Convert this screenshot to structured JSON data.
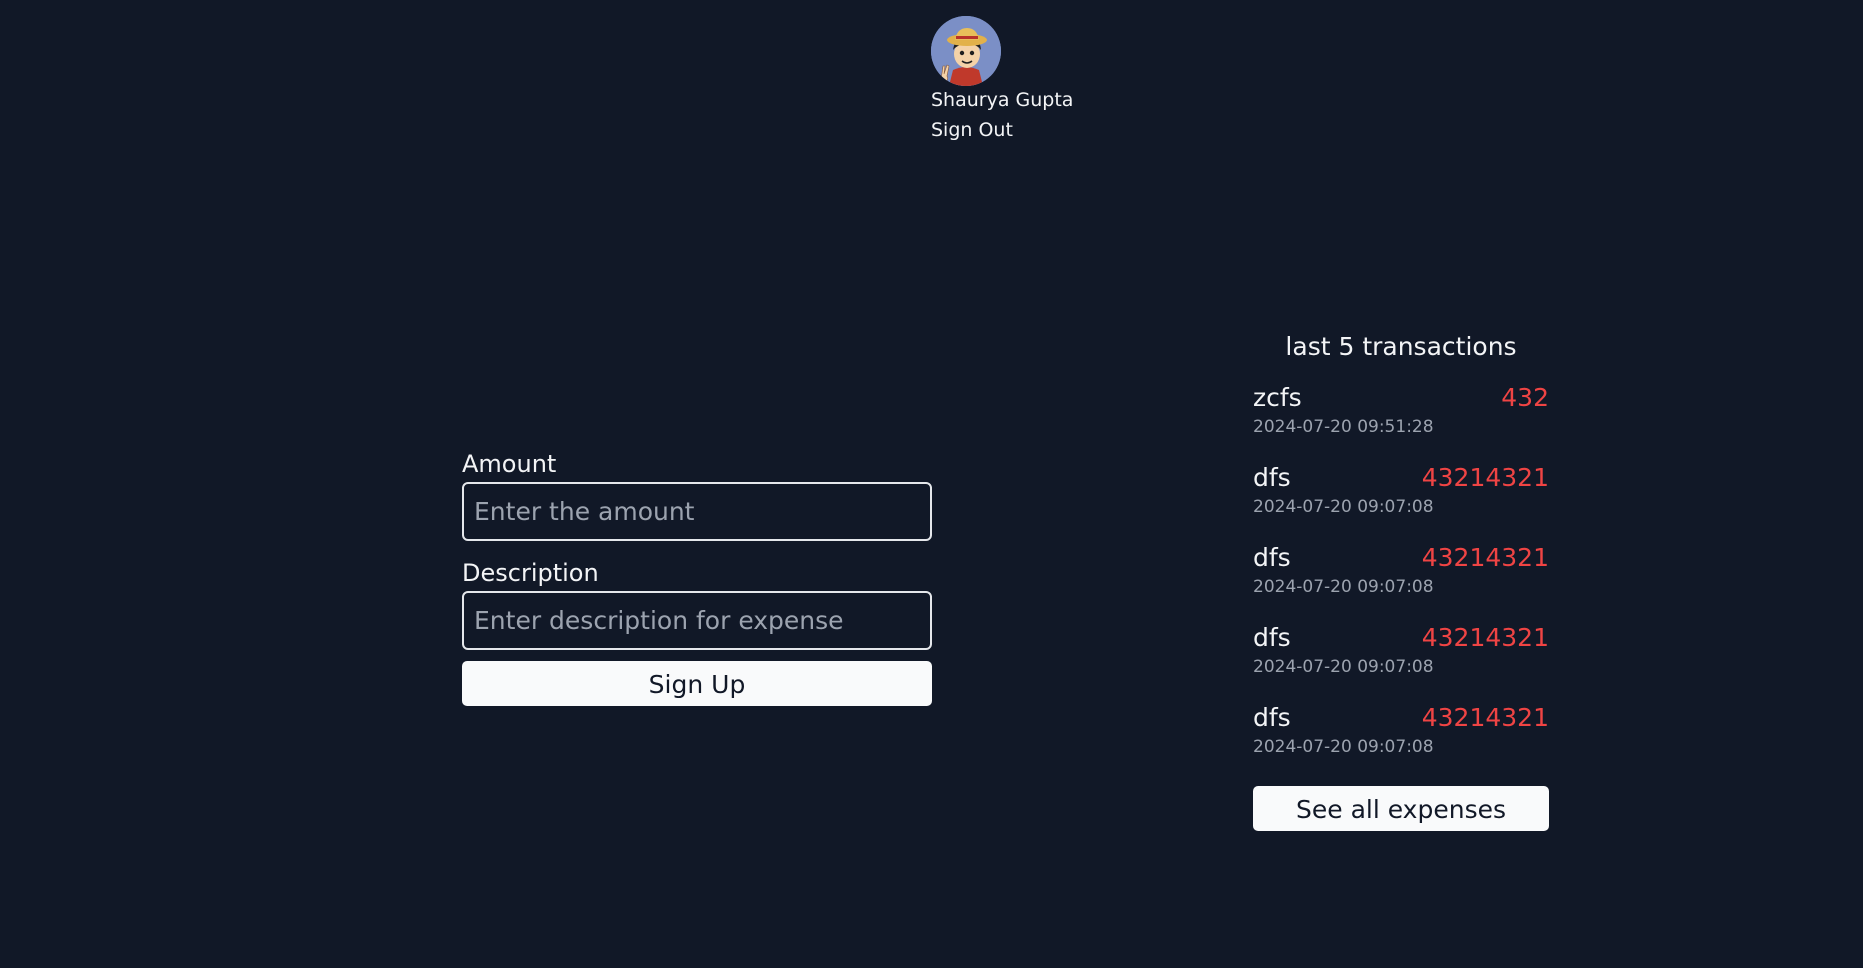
{
  "user": {
    "name": "Shaurya Gupta",
    "sign_out_label": "Sign Out",
    "avatar_icon": "anime-character-avatar"
  },
  "form": {
    "amount_label": "Amount",
    "amount_placeholder": "Enter the amount",
    "amount_value": "",
    "description_label": "Description",
    "description_placeholder": "Enter description for expense",
    "description_value": "",
    "submit_label": "Sign Up"
  },
  "transactions": {
    "title": "last 5 transactions",
    "amount_color": "#ef4444",
    "items": [
      {
        "description": "zcfs",
        "amount": "432",
        "date": "2024-07-20 09:51:28"
      },
      {
        "description": "dfs",
        "amount": "43214321",
        "date": "2024-07-20 09:07:08"
      },
      {
        "description": "dfs",
        "amount": "43214321",
        "date": "2024-07-20 09:07:08"
      },
      {
        "description": "dfs",
        "amount": "43214321",
        "date": "2024-07-20 09:07:08"
      },
      {
        "description": "dfs",
        "amount": "43214321",
        "date": "2024-07-20 09:07:08"
      }
    ],
    "see_all_label": "See all expenses"
  }
}
